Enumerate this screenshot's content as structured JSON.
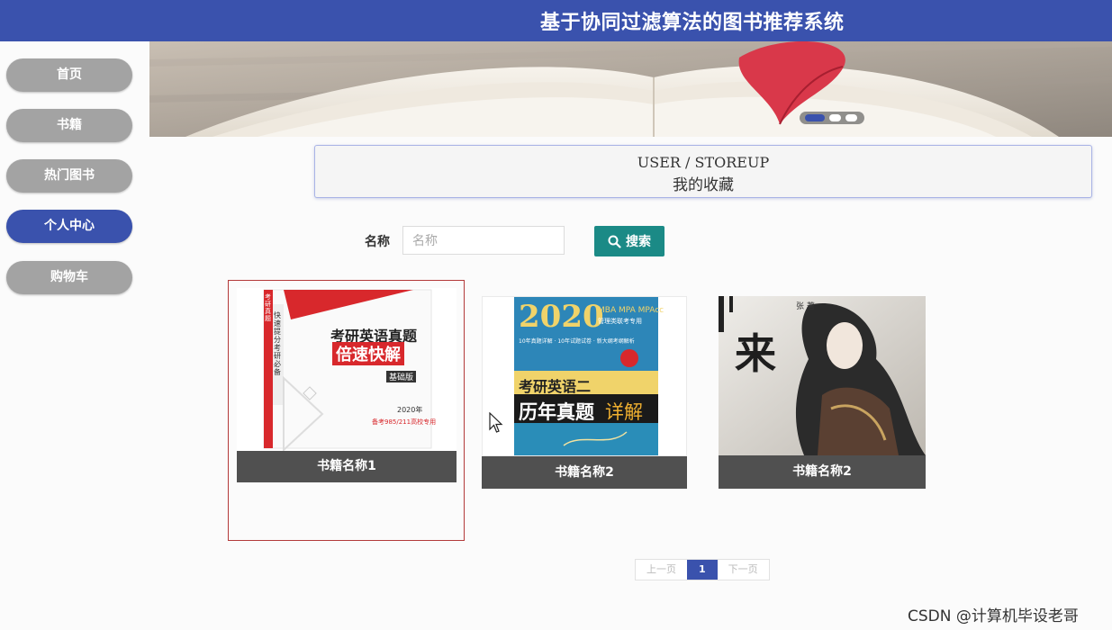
{
  "header": {
    "title": "基于协同过滤算法的图书推荐系统"
  },
  "sidebar": {
    "items": [
      {
        "label": "首页",
        "active": false
      },
      {
        "label": "书籍",
        "active": false
      },
      {
        "label": "热门图书",
        "active": false
      },
      {
        "label": "个人中心",
        "active": true
      },
      {
        "label": "购物车",
        "active": false
      }
    ]
  },
  "banner": {
    "slide_count": 3,
    "active_slide": 1
  },
  "breadcrumb": {
    "path": "USER / STOREUP",
    "title": "我的收藏"
  },
  "search": {
    "label": "名称",
    "placeholder": "名称",
    "value": "",
    "button_label": "搜索",
    "button_icon": "search-icon"
  },
  "books": [
    {
      "name": "书籍名称1",
      "cover": {
        "series": "考研真题",
        "title_line1": "考研英语真题",
        "title_line2": "倍速快解",
        "edition": "基础版",
        "side_text": "快速提分 考研必备",
        "year": "2020年",
        "tagline": "备考985/211高校专用"
      }
    },
    {
      "name": "书籍名称2",
      "cover": {
        "year": "2020",
        "programs": "MBA MPA MPAcc",
        "subtitle": "管理类联考专用",
        "line": "10年真题详解 · 10年试题试卷 · 新大纲考纲解析",
        "title_a": "考研英语二",
        "title_b": "历年真题",
        "title_c": "详解"
      }
    },
    {
      "name": "书籍名称2",
      "cover": {
        "big_char": "来",
        "small": "张 著"
      }
    }
  ],
  "pagination": {
    "prev": "上一页",
    "current": "1",
    "next": "下一页"
  },
  "watermark": "CSDN @计算机毕设老哥",
  "colors": {
    "header": "#3a52ad",
    "nav_inactive": "#a3a3a3",
    "nav_active": "#3a52ad",
    "search_button": "#1b8a86",
    "caption_bg": "#505050",
    "selected_border": "#b33a3a"
  }
}
